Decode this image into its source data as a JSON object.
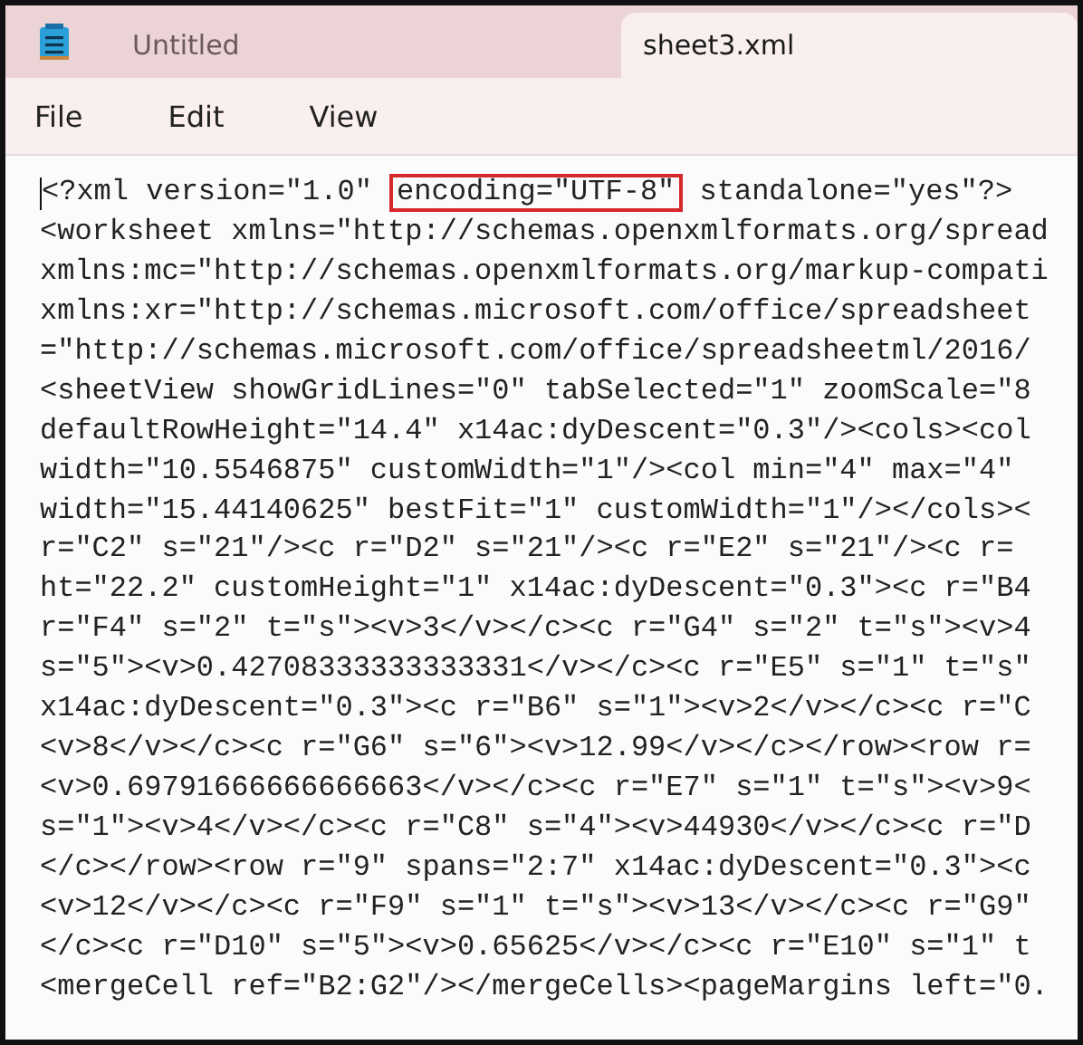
{
  "tabs": [
    {
      "label": "Untitled",
      "selected": false
    },
    {
      "label": "sheet3.xml",
      "selected": true
    }
  ],
  "menu": [
    "File",
    "Edit",
    "View"
  ],
  "lines": [
    [
      {
        "text": "<?xml version=\"1.0\" ",
        "highlighted": false
      },
      {
        "text": "encoding=\"UTF-8\"",
        "highlighted": true
      },
      {
        "text": " standalone=\"yes\"?>",
        "highlighted": false
      }
    ],
    "<worksheet xmlns=\"http://schemas.openxmlformats.org/spread",
    "xmlns:mc=\"http://schemas.openxmlformats.org/markup-compati",
    "xmlns:xr=\"http://schemas.microsoft.com/office/spreadsheet",
    "=\"http://schemas.microsoft.com/office/spreadsheetml/2016/",
    "<sheetView showGridLines=\"0\" tabSelected=\"1\" zoomScale=\"8",
    "defaultRowHeight=\"14.4\" x14ac:dyDescent=\"0.3\"/><cols><col",
    "width=\"10.5546875\" customWidth=\"1\"/><col min=\"4\" max=\"4\"",
    "width=\"15.44140625\" bestFit=\"1\" customWidth=\"1\"/></cols><",
    "r=\"C2\" s=\"21\"/><c r=\"D2\" s=\"21\"/><c r=\"E2\" s=\"21\"/><c r=",
    "ht=\"22.2\" customHeight=\"1\" x14ac:dyDescent=\"0.3\"><c r=\"B4",
    "r=\"F4\" s=\"2\" t=\"s\"><v>3</v></c><c r=\"G4\" s=\"2\" t=\"s\"><v>4",
    "s=\"5\"><v>0.42708333333333331</v></c><c r=\"E5\" s=\"1\" t=\"s\"",
    "x14ac:dyDescent=\"0.3\"><c r=\"B6\" s=\"1\"><v>2</v></c><c r=\"C",
    "<v>8</v></c><c r=\"G6\" s=\"6\"><v>12.99</v></c></row><row r=",
    "<v>0.69791666666666663</v></c><c r=\"E7\" s=\"1\" t=\"s\"><v>9<",
    "s=\"1\"><v>4</v></c><c r=\"C8\" s=\"4\"><v>44930</v></c><c r=\"D",
    "</c></row><row r=\"9\" spans=\"2:7\" x14ac:dyDescent=\"0.3\"><c",
    "<v>12</v></c><c r=\"F9\" s=\"1\" t=\"s\"><v>13</v></c><c r=\"G9\"",
    "</c><c r=\"D10\" s=\"5\"><v>0.65625</v></c><c r=\"E10\" s=\"1\" t",
    "<mergeCell ref=\"B2:G2\"/></mergeCells><pageMargins left=\"0."
  ]
}
